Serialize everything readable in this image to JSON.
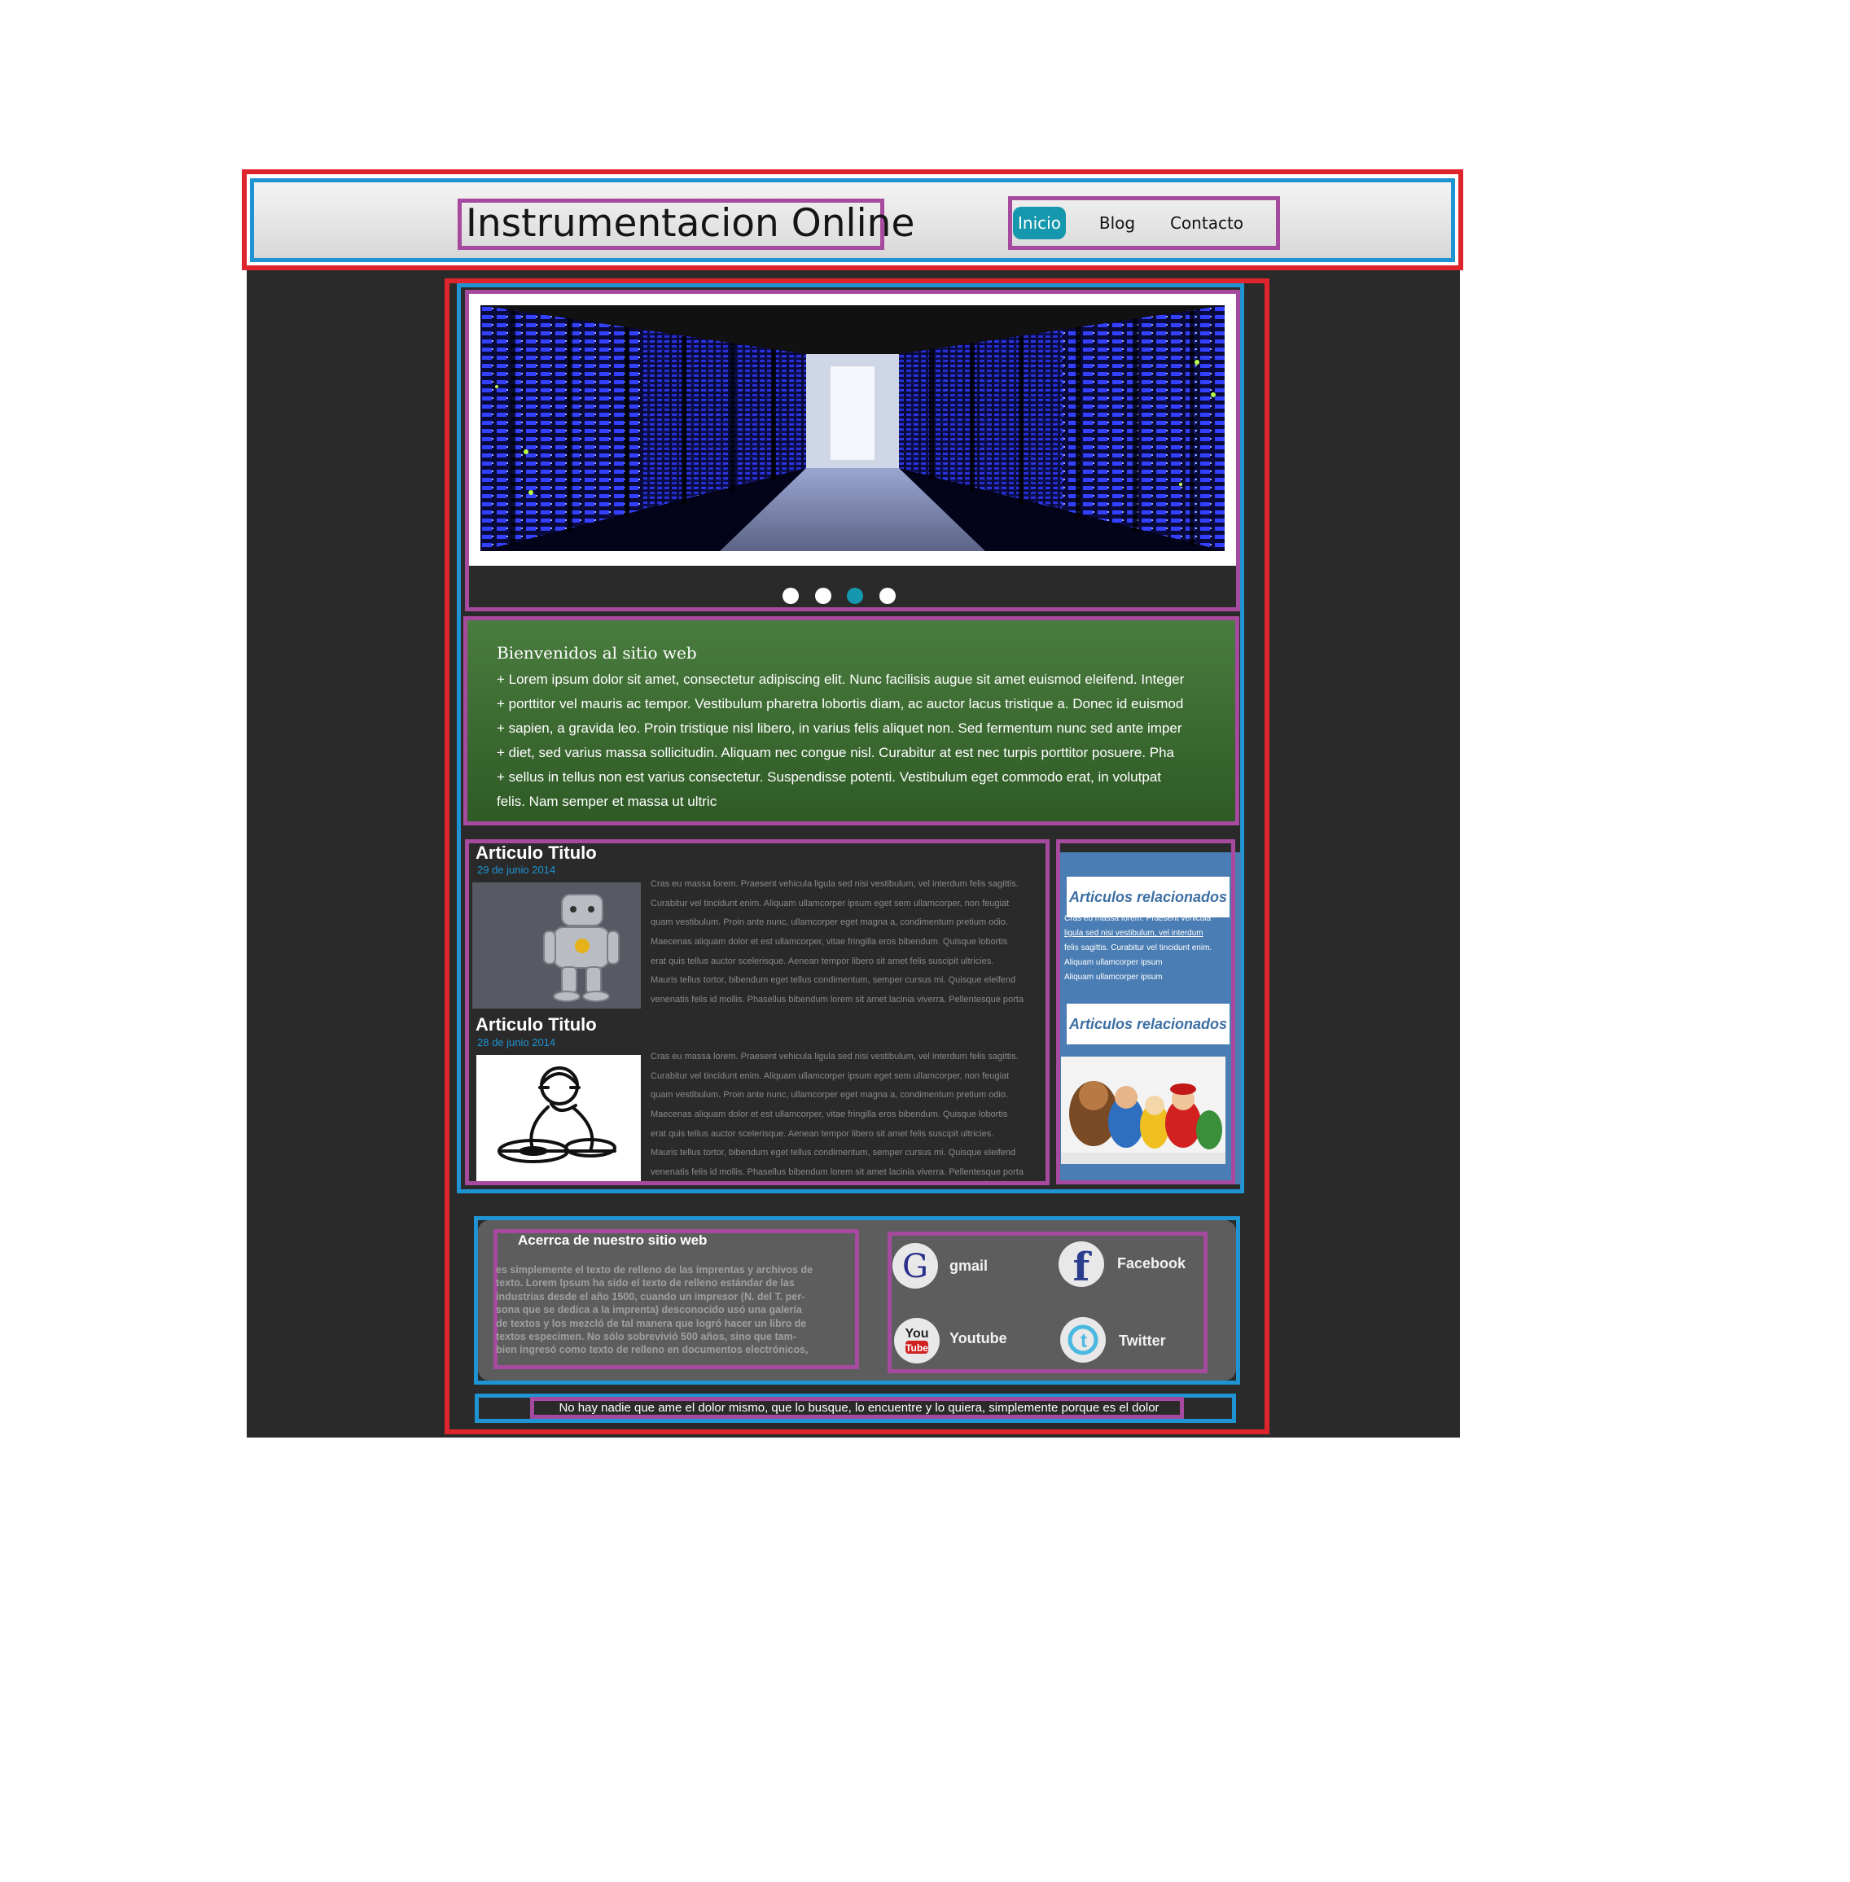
{
  "header": {
    "site_title": "Instrumentacion Online",
    "nav": [
      "Inicio",
      "Blog",
      "Contacto"
    ],
    "active_nav": "Inicio"
  },
  "slider": {
    "slide_count": 4,
    "active_slide": 3,
    "image": "server-room-corridor"
  },
  "welcome": {
    "title": "Bienvenidos al sitio web",
    "lines": [
      "+ Lorem ipsum dolor sit amet, consectetur adipiscing elit. Nunc facilisis augue sit amet euismod eleifend. Integer",
      "+ porttitor vel mauris ac tempor. Vestibulum pharetra lobortis diam, ac auctor lacus tristique a. Donec id euismod",
      "+ sapien, a gravida leo. Proin tristique nisl libero, in varius felis aliquet non. Sed fermentum nunc sed ante imper",
      "+ diet, sed varius massa sollicitudin. Aliquam nec congue nisl. Curabitur at est nec turpis porttitor posuere. Pha",
      "+ sellus in tellus non est varius consectetur. Suspendisse potenti. Vestibulum eget commodo erat, in volutpat",
      "felis. Nam semper et massa ut ultric"
    ]
  },
  "articles": [
    {
      "title": "Articulo Titulo",
      "date": "29 de junio 2014",
      "image": "robot-figure",
      "lines": [
        "Cras eu massa lorem. Praesent vehicula ligula sed nisi vestibulum, vel interdum felis sagittis.",
        "Curabitur vel tincidunt enim. Aliquam ullamcorper ipsum eget sem ullamcorper, non feugiat",
        "quam vestibulum. Proin ante nunc, ullamcorper eget magna a, condimentum pretium odio.",
        "Maecenas aliquam dolor et est ullamcorper, vitae fringilla eros bibendum. Quisque lobortis",
        "erat quis tellus auctor scelerisque. Aenean tempor libero sit amet felis suscipit ultricies.",
        "Mauris tellus tortor, bibendum eget tellus condimentum, semper cursus mi. Quisque eleifend",
        "venenatis felis id mollis. Phasellus bibendum lorem sit amet lacinia viverra. Pellentesque porta"
      ]
    },
    {
      "title": "Articulo Titulo",
      "date": "28 de junio 2014",
      "image": "dj-drawing",
      "lines": [
        "Cras eu massa lorem. Praesent vehicula ligula sed nisi vestibulum, vel interdum felis sagittis.",
        "Curabitur vel tincidunt enim. Aliquam ullamcorper ipsum eget sem ullamcorper, non feugiat",
        "quam vestibulum. Proin ante nunc, ullamcorper eget magna a, condimentum pretium odio.",
        "Maecenas aliquam dolor et est ullamcorper, vitae fringilla eros bibendum. Quisque lobortis",
        "erat quis tellus auctor scelerisque. Aenean tempor libero sit amet felis suscipit ultricies.",
        "Mauris tellus tortor, bibendum eget tellus condimentum, semper cursus mi. Quisque eleifend",
        "venenatis felis id mollis. Phasellus bibendum lorem sit amet lacinia viverra. Pellentesque porta"
      ]
    }
  ],
  "sidebar": {
    "heading_1": "Articulos relacionados",
    "lines": [
      "Cras eu massa lorem. Praesent vehicula",
      "ligula sed nisi vestibulum, vel interdum",
      "felis sagittis. Curabitur vel tincidunt enim.",
      "Aliquam ullamcorper ipsum",
      "Aliquam ullamcorper ipsum"
    ],
    "heading_2": "Articulos relacionados",
    "image": "game-characters-group"
  },
  "footer": {
    "about_title": "Acerrca de nuestro sitio web",
    "about_lines": [
      "es simplemente el texto de relleno de las imprentas y archivos de",
      "texto. Lorem Ipsum ha sido el texto de relleno estándar de las",
      "industrias desde el año 1500, cuando un impresor (N. del T. per-",
      "sona que se dedica a la imprenta) desconocido usó una galería",
      "de textos y los mezcló de tal manera que logró hacer un libro de",
      "textos especimen. No sólo sobrevivió 500 años, sino que tam-",
      "bien ingresó como texto de relleno en documentos electrónicos,"
    ],
    "social": {
      "gmail": "gmail",
      "facebook": "Facebook",
      "youtube": "Youtube",
      "twitter": "Twitter"
    },
    "bottom_text": "No hay nadie que ame el dolor mismo, que lo busque, lo encuentre y lo quiera, simplemente porque es el dolor"
  },
  "colors": {
    "accent": "#1597ad",
    "page_dark": "#2a2a2a",
    "welcome_green": "#3f6f33",
    "sidebar_blue": "#4a7db3",
    "annotation_red": "#e0242c",
    "annotation_blue": "#1e94d2",
    "annotation_purple": "#a54a9f"
  }
}
